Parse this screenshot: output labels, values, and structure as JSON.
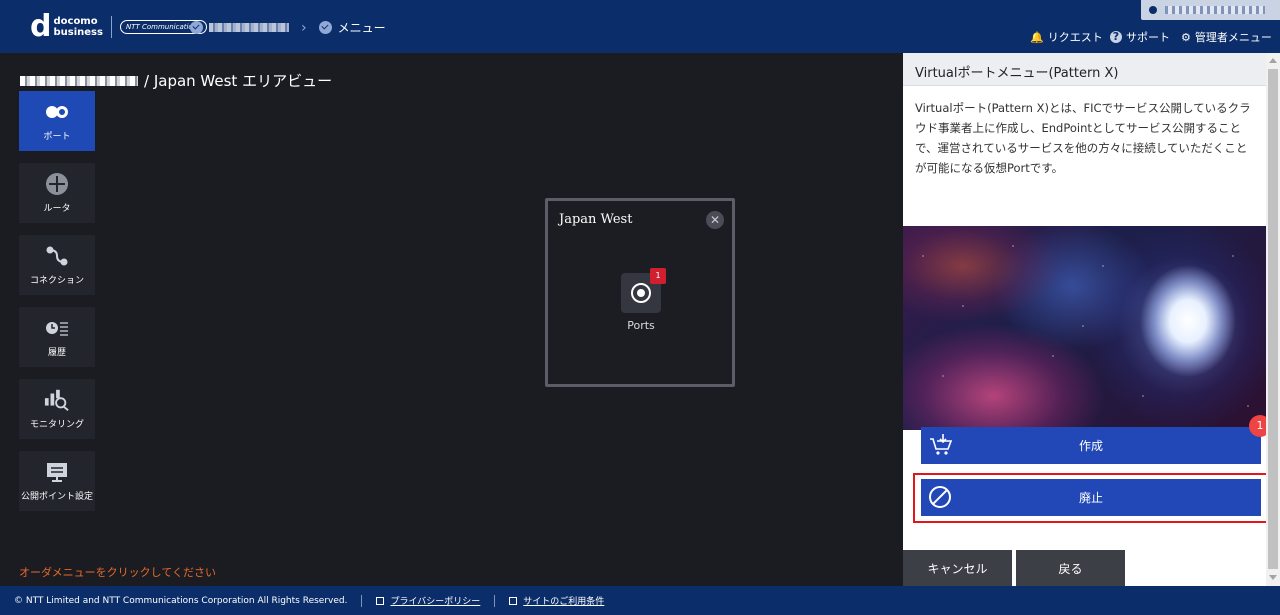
{
  "header": {
    "logo_main": "d",
    "logo_line1": "docomo",
    "logo_line2": "business",
    "logo_ntt": "NTT Communications",
    "breadcrumb_menu": "メニュー",
    "nav_request": "リクエスト",
    "nav_support": "サポート",
    "nav_admin": "管理者メニュー"
  },
  "page": {
    "title_suffix": "/ Japan West エリアビュー",
    "order_message": "オーダメニューをクリックしてください"
  },
  "sidebar": {
    "items": [
      {
        "label": "ポート",
        "icon": "port-icon",
        "active": true
      },
      {
        "label": "ルータ",
        "icon": "router-icon",
        "active": false
      },
      {
        "label": "コネクション",
        "icon": "connection-icon",
        "active": false
      },
      {
        "label": "履歴",
        "icon": "history-icon",
        "active": false
      },
      {
        "label": "モニタリング",
        "icon": "monitoring-icon",
        "active": false
      },
      {
        "label": "公開ポイント設定",
        "icon": "public-point-icon",
        "active": false
      }
    ]
  },
  "area_panel": {
    "title": "Japan West",
    "port_label": "Ports",
    "port_badge": "1"
  },
  "right_panel": {
    "title": "Virtualポートメニュー(Pattern X)",
    "description": "Virtualポート(Pattern X)とは、FICでサービス公開しているクラウド事業者上に作成し、EndPointとしてサービス公開することで、運営されているサービスを他の方々に接続していただくことが可能になる仮想Portです。",
    "create_label": "作成",
    "create_badge": "1",
    "abolish_label": "廃止",
    "cancel_label": "キャンセル",
    "back_label": "戻る"
  },
  "footer": {
    "copyright": "© NTT Limited and NTT Communications Corporation All Rights Reserved.",
    "privacy": "プライバシーポリシー",
    "terms": "サイトのご利用条件"
  },
  "colors": {
    "header_bg": "#0b2e6b",
    "accent_blue": "#2248b8",
    "highlight_red": "#e0161b",
    "order_orange": "#e8692b"
  }
}
